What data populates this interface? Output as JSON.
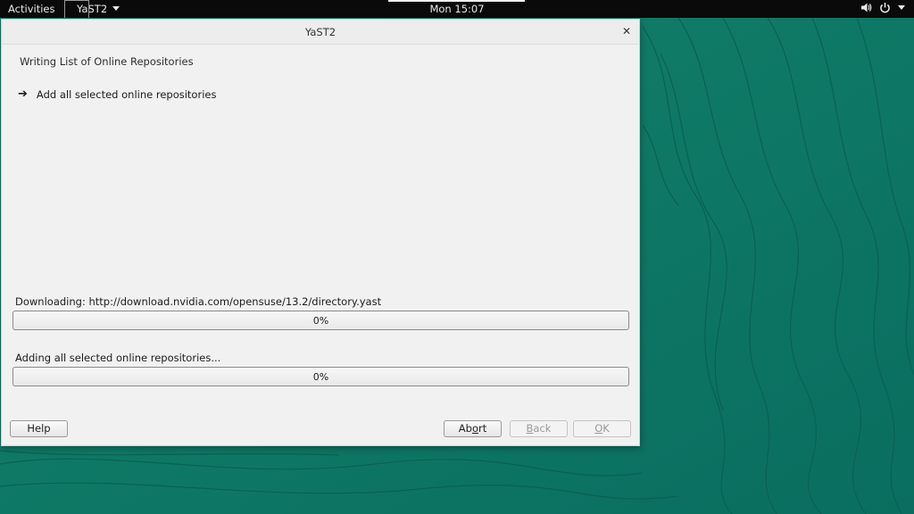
{
  "topbar": {
    "activities": "Activities",
    "app_name": "YaST2",
    "clock": "Mon 15:07",
    "icons": [
      "speaker-icon",
      "power-icon",
      "chevron-down-icon"
    ]
  },
  "window": {
    "title": "YaST2",
    "heading": "Writing List of Online Repositories",
    "step": "Add all selected online repositories",
    "progress1": {
      "label": "Downloading: http://download.nvidia.com/opensuse/13.2/directory.yast",
      "value_text": "0%",
      "fraction": 0
    },
    "progress2": {
      "label": "Adding all selected online repositories...",
      "value_text": "0%",
      "fraction": 0
    },
    "buttons": {
      "help": "Help",
      "abort_pre": "Ab",
      "abort_u": "o",
      "abort_post": "rt",
      "back_u": "B",
      "back_post": "ack",
      "ok_u": "O",
      "ok_post": "K"
    }
  },
  "colors": {
    "desktop": "#0d7a63",
    "window": "#f1f1f1",
    "topbar": "#0a0a0a"
  }
}
